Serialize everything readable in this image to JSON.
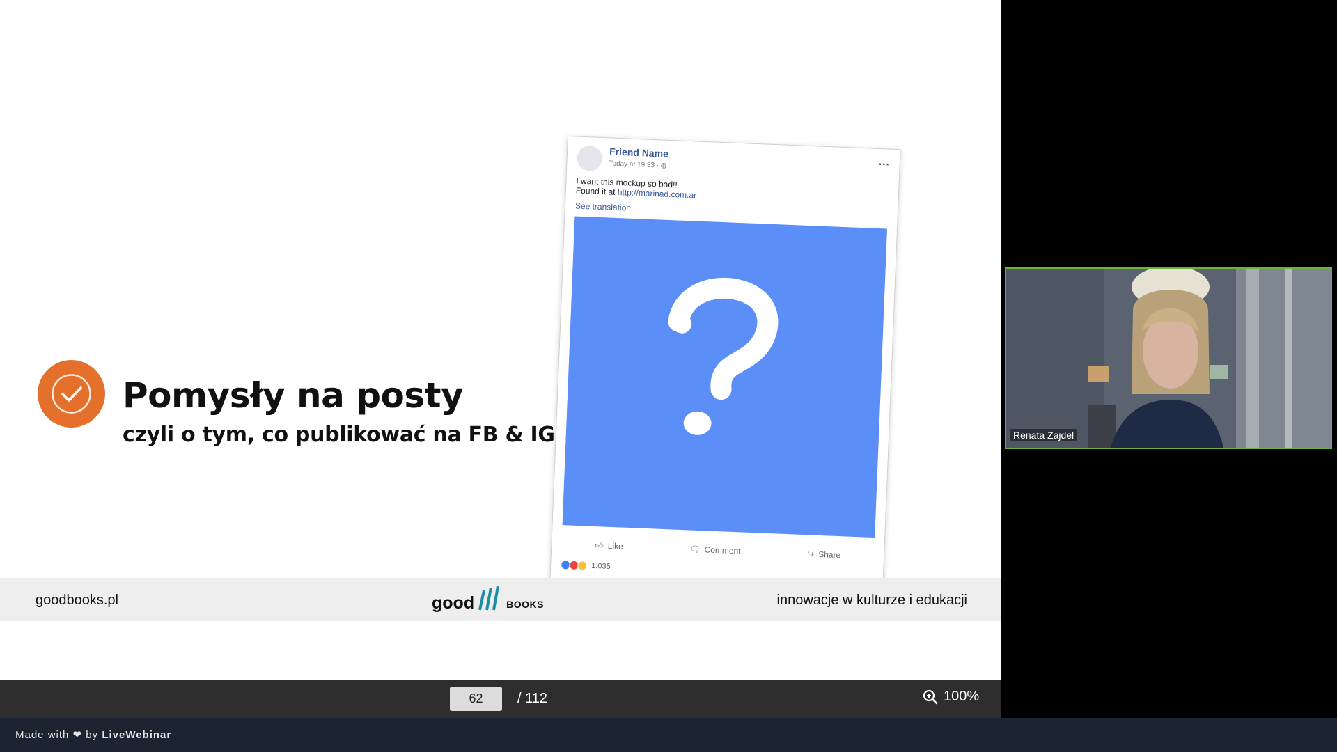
{
  "slide": {
    "title": "Pomysły na posty",
    "subtitle": "czyli o tym, co publikować na FB & IG",
    "accent_color": "#e5702c",
    "check_icon": "check-circle-icon"
  },
  "fb_post": {
    "friend_name": "Friend Name",
    "time": "Today at 19:33 · ",
    "text_line1": "I want this mockup so bad!!",
    "text_line2_prefix": "Found it at ",
    "text_link": "http://marinad.com.ar",
    "see_translation": "See translation",
    "image_color": "#5b8ff7",
    "image_icon": "question-mark-icon",
    "action_like": "Like",
    "action_comment": "Comment",
    "action_share": "Share",
    "reaction_count": "1.035"
  },
  "footer": {
    "left": "goodbooks.pl",
    "logo_good": "good",
    "logo_books": "books",
    "right": "innowacje w kulturze i edukacji"
  },
  "toolbar": {
    "page_value": "62",
    "page_total": "/ 112",
    "zoom": "100%"
  },
  "branding": {
    "made_with": "Made with",
    "by": "by",
    "name": "LiveWebinar"
  },
  "webcam": {
    "participant_name": "Renata Zajdel",
    "border_color": "#6bb437"
  }
}
